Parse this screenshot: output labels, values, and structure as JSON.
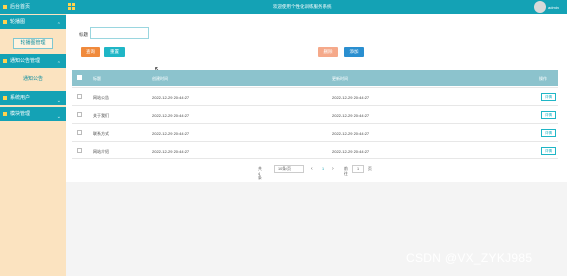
{
  "header": {
    "title": "欢迎使用个性化训练服务系统",
    "user": "admin",
    "accent": "#14a2b5"
  },
  "sidebar": {
    "items": [
      {
        "label": "后台首页",
        "icon": "home-icon"
      },
      {
        "label": "轮播图",
        "icon": "image-icon"
      },
      {
        "label": "轮播图管理",
        "sub": true,
        "active": true
      },
      {
        "label": "通知公告管理",
        "icon": "notice-icon"
      },
      {
        "label": "通知公告",
        "sub": true
      },
      {
        "label": "系统用户",
        "icon": "user-icon"
      },
      {
        "label": "模块管理",
        "icon": "module-icon"
      }
    ]
  },
  "search": {
    "label": "标题",
    "value": "",
    "search_btn": "查询",
    "reset_btn": "重置"
  },
  "actions": {
    "delete_btn": "删除",
    "add_btn": "添加"
  },
  "table": {
    "headers": [
      "标题",
      "创建时间",
      "更新时间",
      "操作"
    ],
    "rows": [
      {
        "title": "网站公告",
        "created": "2022-12-29 20:44:27",
        "updated": "2022-12-29 20:44:27",
        "action": "详情"
      },
      {
        "title": "关于我们",
        "created": "2022-12-29 20:44:27",
        "updated": "2022-12-29 20:44:27",
        "action": "详情"
      },
      {
        "title": "联系方式",
        "created": "2022-12-29 20:44:27",
        "updated": "2022-12-29 20:44:27",
        "action": "详情"
      },
      {
        "title": "网站介绍",
        "created": "2022-12-29 20:44:27",
        "updated": "2022-12-29 20:44:27",
        "action": "详情"
      }
    ]
  },
  "pagination": {
    "total": "共 4 条",
    "page_size": "10条/页",
    "prev": "‹",
    "current": "1",
    "next": "›",
    "goto_label": "前往",
    "goto_value": "1",
    "goto_suffix": "页"
  },
  "watermark": "CSDN @VX_ZYKJ985"
}
